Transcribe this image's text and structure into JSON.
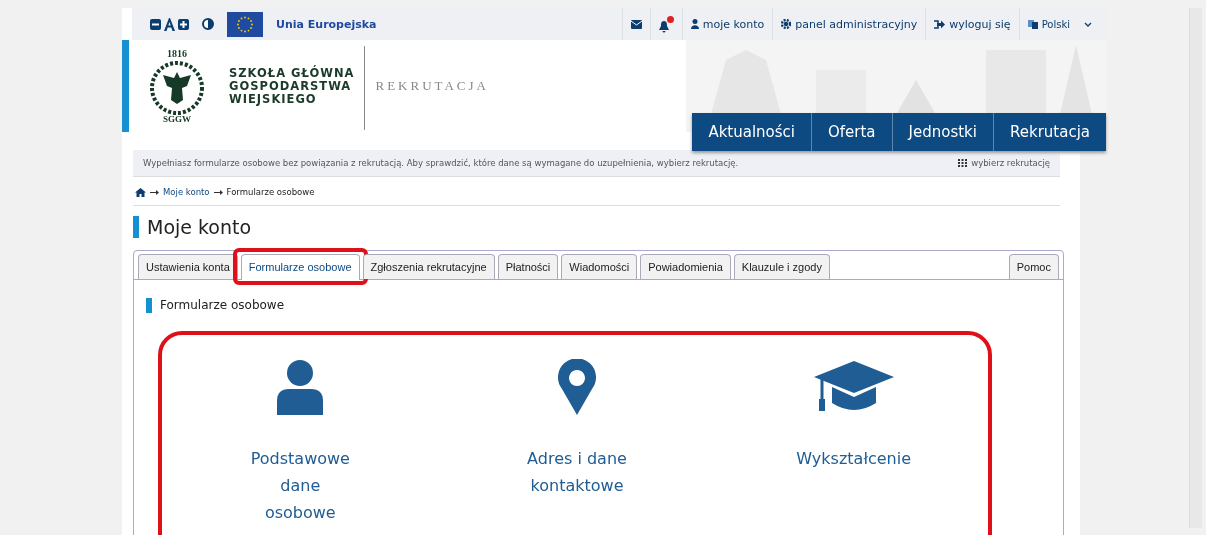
{
  "topbar": {
    "eu_label": "Unia Europejska",
    "links": [
      {
        "kind": "account",
        "label": "moje konto"
      },
      {
        "kind": "admin",
        "label": "panel administracyjny"
      },
      {
        "kind": "logout",
        "label": "wyloguj się"
      }
    ],
    "language": "Polski",
    "notifications_badge": true
  },
  "header": {
    "logo_year": "1816",
    "logo_initials": "SGGW",
    "school_name": [
      "SZKOŁA GŁÓWNA",
      "GOSPODARSTWA",
      "WIEJSKIEGO"
    ],
    "section": "REKRUTACJA"
  },
  "nav": [
    "Aktualności",
    "Oferta",
    "Jednostki",
    "Rekrutacja"
  ],
  "info_bar": {
    "text": "Wypełniasz formularze osobowe bez powiązania z rekrutacją. Aby sprawdzić, które dane są wymagane do uzupełnienia, wybierz rekrutację.",
    "action": "wybierz rekrutację"
  },
  "breadcrumb": [
    "Moje konto",
    "Formularze osobowe"
  ],
  "page_title": "Moje konto",
  "tabs": [
    {
      "label": "Ustawienia konta",
      "selected": false,
      "highlighted": false
    },
    {
      "label": "Formularze osobowe",
      "selected": true,
      "highlighted": true
    },
    {
      "label": "Zgłoszenia rekrutacyjne",
      "selected": false,
      "highlighted": false
    },
    {
      "label": "Płatności",
      "selected": false,
      "highlighted": false
    },
    {
      "label": "Wiadomości",
      "selected": false,
      "highlighted": false
    },
    {
      "label": "Powiadomienia",
      "selected": false,
      "highlighted": false
    },
    {
      "label": "Klauzule i zgody",
      "selected": false,
      "highlighted": false
    }
  ],
  "help_tab": {
    "label": "Pomoc",
    "selected": false
  },
  "section_title": "Formularze osobowe",
  "forms_highlighted": true,
  "forms": [
    {
      "kind": "person",
      "lines": [
        "Podstawowe",
        "dane",
        "osobowe"
      ]
    },
    {
      "kind": "pin",
      "lines": [
        "Adres i dane",
        "kontaktowe"
      ]
    },
    {
      "kind": "cap",
      "lines": [
        "Wykształcenie"
      ]
    }
  ]
}
